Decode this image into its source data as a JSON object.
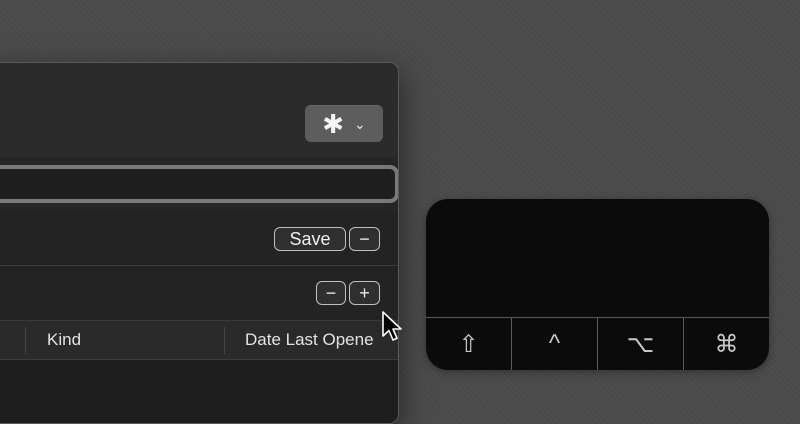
{
  "window": {
    "action_button": {
      "icon": "gear-icon",
      "gear_glyph": "✱",
      "chevron_glyph": "⌄"
    },
    "search": {
      "value": "",
      "placeholder": ""
    },
    "criteria_rows": [
      {
        "save_label": "Save",
        "minus_label": "−"
      },
      {
        "minus_label": "−",
        "plus_label": "+"
      }
    ],
    "columns": [
      "Kind",
      "Date Last Opene"
    ]
  },
  "modifier_keys": [
    {
      "name": "shift",
      "glyph": "⇧"
    },
    {
      "name": "control",
      "glyph": "^"
    },
    {
      "name": "option",
      "glyph": "⌥"
    },
    {
      "name": "command",
      "glyph": "⌘"
    }
  ]
}
